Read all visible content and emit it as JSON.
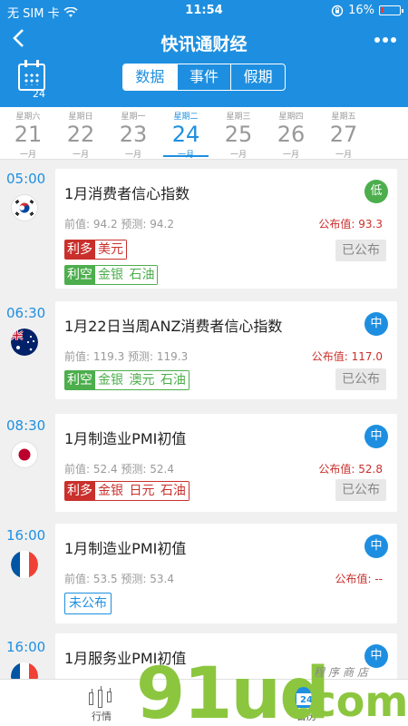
{
  "status_bar": {
    "carrier": "无 SIM 卡",
    "time": "11:54",
    "battery": "16%",
    "battery_level": 0.16
  },
  "nav": {
    "title": "快讯通财经",
    "back_icon": "chevron-left-icon",
    "more_icon": "more-dots-icon"
  },
  "calendar_badge": "24",
  "tabs": [
    {
      "label": "数据",
      "active": true
    },
    {
      "label": "事件",
      "active": false
    },
    {
      "label": "假期",
      "active": false
    }
  ],
  "dates": [
    {
      "weekday": "星期六",
      "day": "21",
      "month": "一月",
      "active": false
    },
    {
      "weekday": "星期日",
      "day": "22",
      "month": "一月",
      "active": false
    },
    {
      "weekday": "星期一",
      "day": "23",
      "month": "一月",
      "active": false
    },
    {
      "weekday": "星期二",
      "day": "24",
      "month": "一月",
      "active": true
    },
    {
      "weekday": "星期三",
      "day": "25",
      "month": "一月",
      "active": false
    },
    {
      "weekday": "星期四",
      "day": "26",
      "month": "一月",
      "active": false
    },
    {
      "weekday": "星期五",
      "day": "27",
      "month": "一月",
      "active": false
    }
  ],
  "events": [
    {
      "time": "05:00",
      "flag": "south-korea-flag-icon",
      "name": "1月消费者信心指数",
      "importance": "低",
      "prev_forecast": "前值: 94.2  预测: 94.2",
      "published": "公布值: 93.3",
      "tags": [
        {
          "kind": "利多",
          "items": [
            "美元"
          ]
        },
        {
          "kind": "利空",
          "items": [
            "金银",
            "石油"
          ]
        }
      ],
      "status": "已公布"
    },
    {
      "time": "06:30",
      "flag": "australia-flag-icon",
      "name": "1月22日当周ANZ消费者信心指数",
      "importance": "中",
      "prev_forecast": "前值: 119.3  预测: 119.3",
      "published": "公布值: 117.0",
      "tags": [
        {
          "kind": "利空",
          "items": [
            "金银",
            "澳元",
            "石油"
          ]
        }
      ],
      "status": "已公布"
    },
    {
      "time": "08:30",
      "flag": "japan-flag-icon",
      "name": "1月制造业PMI初值",
      "importance": "中",
      "prev_forecast": "前值: 52.4  预测: 52.4",
      "published": "公布值: 52.8",
      "tags": [
        {
          "kind": "利多",
          "items": [
            "金银",
            "日元",
            "石油"
          ]
        }
      ],
      "status": "已公布"
    },
    {
      "time": "16:00",
      "flag": "france-flag-icon",
      "name": "1月制造业PMI初值",
      "importance": "中",
      "prev_forecast": "前值: 53.5  预测: 53.4",
      "published": "公布值: --",
      "tags": [],
      "status": "未公布"
    },
    {
      "time": "16:00",
      "flag": "france-flag-icon",
      "name": "1月服务业PMI初值",
      "importance": "中"
    }
  ],
  "bottom_tabs": [
    {
      "label": "行情",
      "icon": "candlestick-icon"
    },
    {
      "label": "日历",
      "icon": "calendar-icon"
    }
  ],
  "watermark": {
    "main": "91ud",
    "suffix": ".com",
    "tagline": "程序商店"
  },
  "colors": {
    "brand_blue": "#1e8fe0",
    "bullish_red": "#c9302c",
    "bearish_green": "#4cae4c"
  }
}
